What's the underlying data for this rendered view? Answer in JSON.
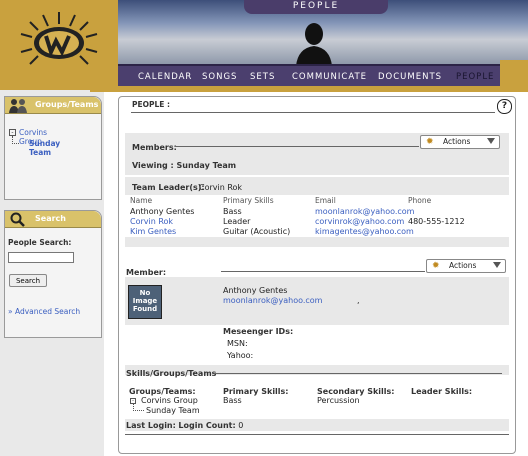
{
  "header": {
    "section_title": "PEOPLE",
    "nav": [
      "CALENDAR",
      "SONGS",
      "SETS",
      "COMMUNICATE",
      "DOCUMENTS",
      "PEOPLE"
    ]
  },
  "sidebar": {
    "groups_box": {
      "title": "Groups/Teams",
      "group": "Corvins Group",
      "team": "Sunday Team"
    },
    "search_box": {
      "title": "Search",
      "label": "People Search:",
      "input_value": "",
      "button": "Search",
      "advanced": "» Advanced Search"
    }
  },
  "main": {
    "title": "PEOPLE :",
    "help": "?",
    "members_label": "Members:",
    "actions_label": "Actions",
    "viewing": "Viewing : Sunday Team",
    "team_leader_label": "Team Leader(s):",
    "team_leader_value": "Corvin Rok",
    "table": {
      "headers": [
        "Name",
        "Primary Skills",
        "Email",
        "Phone"
      ],
      "rows": [
        [
          "Anthony Gentes",
          "Bass",
          "moonlanrok@yahoo.com",
          ""
        ],
        [
          "Corvin Rok",
          "Leader",
          "corvinrok@yahoo.com",
          "480-555-1212"
        ],
        [
          "Kim Gentes",
          "Guitar (Acoustic)",
          "kimagentes@yahoo.com",
          ""
        ]
      ]
    },
    "member": {
      "label": "Member:",
      "actions_label": "Actions",
      "photo_text": [
        "No",
        "Image",
        "Found"
      ],
      "name": "Anthony Gentes",
      "email": "moonlanrok@yahoo.com",
      "comma": ",",
      "messenger_label": "Meseenger IDs:",
      "msn_label": "MSN:",
      "yahoo_label": "Yahoo:"
    },
    "skills": {
      "section_label": "Skills/Groups/Teams",
      "groups_header": "Groups/Teams:",
      "primary_header": "Primary Skills:",
      "secondary_header": "Secondary Skills:",
      "leader_header": "Leader Skills:",
      "group": "Corvins Group",
      "team": "Sunday Team",
      "primary": "Bass",
      "secondary": "Percussion"
    },
    "last_login_label": "Last Login:",
    "login_count_label": "Login Count:",
    "login_count_value": "0"
  },
  "colors": {
    "gold": "#c9a13e",
    "nav_purple": "#4b3f6e",
    "link_blue": "#3b5fc0",
    "panel_gray": "#e8e8e8"
  }
}
